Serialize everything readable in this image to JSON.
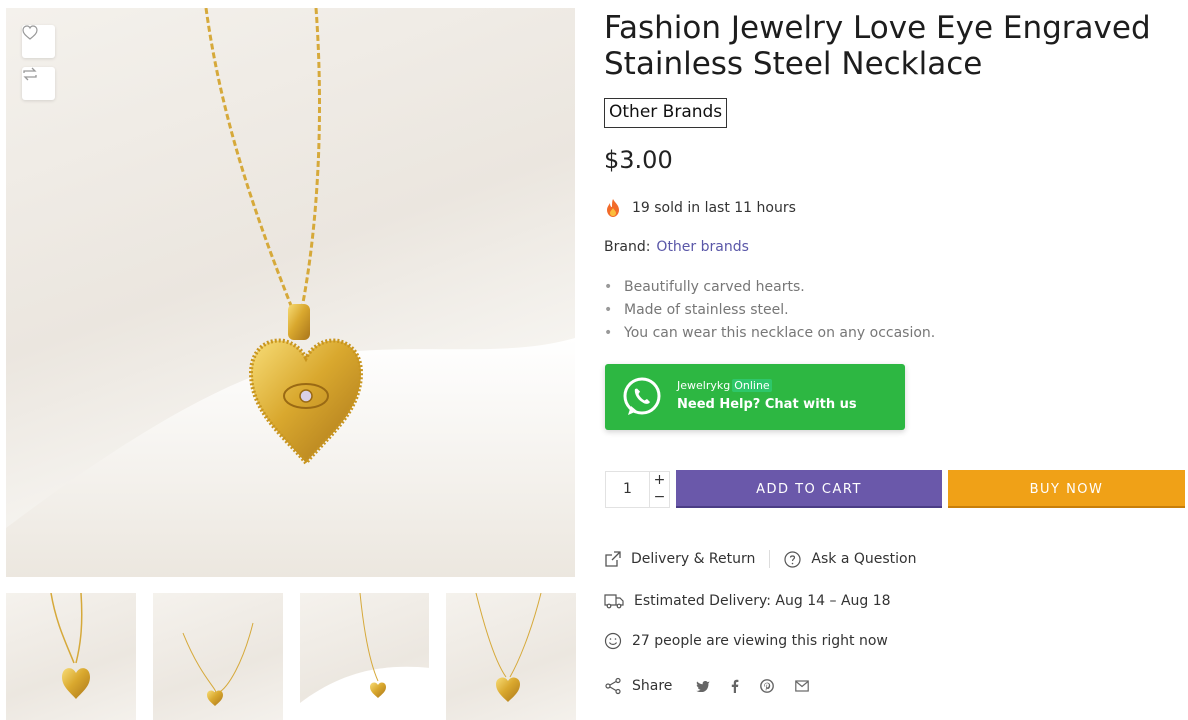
{
  "product": {
    "title": "Fashion Jewelry Love Eye Engraved Stainless Steel Necklace",
    "brand_badge": "Other Brands",
    "price": "$3.00",
    "sold_text": "19 sold in last 11 hours",
    "brand_label": "Brand:",
    "brand_value": "Other brands",
    "features": [
      "Beautifully carved hearts.",
      "Made of stainless steel.",
      "You can wear this necklace on any occasion."
    ]
  },
  "whatsapp": {
    "name": "Jewelrykg",
    "status": "Online",
    "cta": "Need Help? Chat with us",
    "color": "#2db742"
  },
  "purchase": {
    "quantity": "1",
    "plus": "+",
    "minus": "−",
    "add_to_cart": "ADD TO CART",
    "buy_now": "BUY NOW",
    "cart_color": "#6a58aa",
    "buy_color": "#f0a117"
  },
  "meta": {
    "delivery_return": "Delivery & Return",
    "ask_question": "Ask a Question",
    "estimated_delivery": "Estimated Delivery: Aug 14 – Aug 18",
    "viewing": "27 people are viewing this right now",
    "share": "Share"
  },
  "icons": {
    "wishlist": "heart-icon",
    "compare": "compare-icon",
    "sold": "fire-icon",
    "delivery_return": "share-box-icon",
    "ask": "question-circle-icon",
    "estimate": "truck-icon",
    "viewing": "smiley-icon",
    "share": "share-icon",
    "social": [
      "twitter-icon",
      "facebook-icon",
      "pinterest-icon",
      "email-icon"
    ]
  }
}
